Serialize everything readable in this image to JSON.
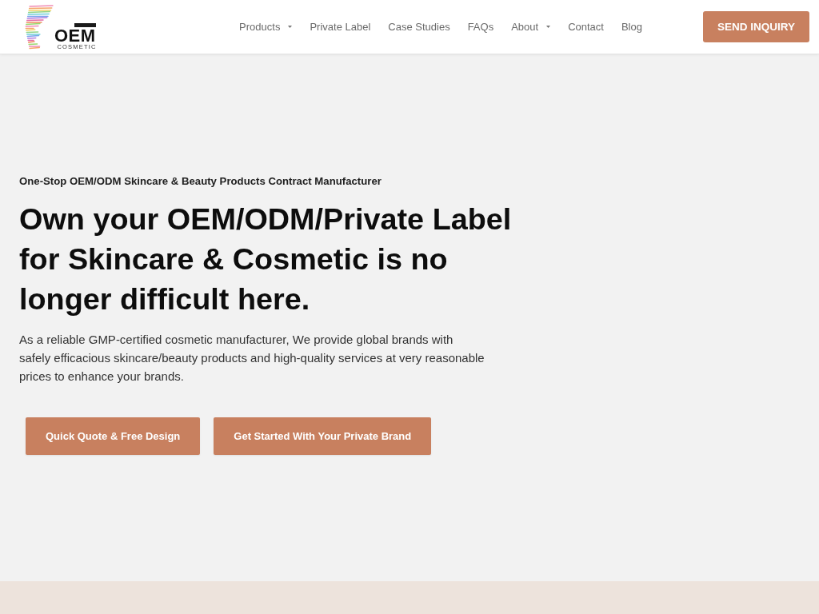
{
  "header": {
    "logo": {
      "wordmark": "OEM",
      "tagline": "COSMETIC"
    },
    "nav": [
      {
        "label": "Products",
        "has_dropdown": true
      },
      {
        "label": "Private Label",
        "has_dropdown": false
      },
      {
        "label": "Case Studies",
        "has_dropdown": false
      },
      {
        "label": "FAQs",
        "has_dropdown": false
      },
      {
        "label": "About",
        "has_dropdown": true
      },
      {
        "label": "Contact",
        "has_dropdown": false
      },
      {
        "label": "Blog",
        "has_dropdown": false
      }
    ],
    "cta": "SEND INQUIRY"
  },
  "hero": {
    "eyebrow": "One-Stop OEM/ODM Skincare & Beauty Products Contract Manufacturer",
    "heading": "Own your OEM/ODM/Private Label for Skincare & Cosmetic is no longer difficult here.",
    "description": "As a reliable GMP-certified cosmetic manufacturer, We provide global brands with safely efficacious skincare/beauty products and high-quality services at very reasonable prices to enhance your brands.",
    "buttons": [
      "Quick Quote & Free Design",
      "Get Started With Your Private Brand"
    ]
  }
}
